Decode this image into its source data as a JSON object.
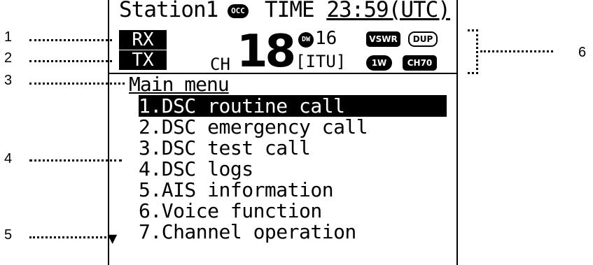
{
  "screen": {
    "station": "Station1",
    "occ_badge": "OCC",
    "time_label": "TIME",
    "time_value": "23:59",
    "time_zone": "(UTC)",
    "rx": "RX",
    "tx": "TX",
    "ch_label": "CH",
    "ch_number": "18",
    "dw_badge": "DW",
    "dw_channel": "16",
    "channel_group": "[ITU]",
    "vswr": "VSWR",
    "dup": "DUP",
    "power": "1W",
    "ch70": "CH70"
  },
  "menu": {
    "title": "Main menu",
    "items": [
      "1.DSC routine call",
      "2.DSC emergency call",
      "3.DSC test call",
      "4.DSC logs",
      "5.AIS information",
      "6.Voice function",
      "7.Channel operation"
    ],
    "more_indicator": "▼"
  },
  "callouts": [
    "1",
    "2",
    "3",
    "4",
    "5",
    "6"
  ]
}
